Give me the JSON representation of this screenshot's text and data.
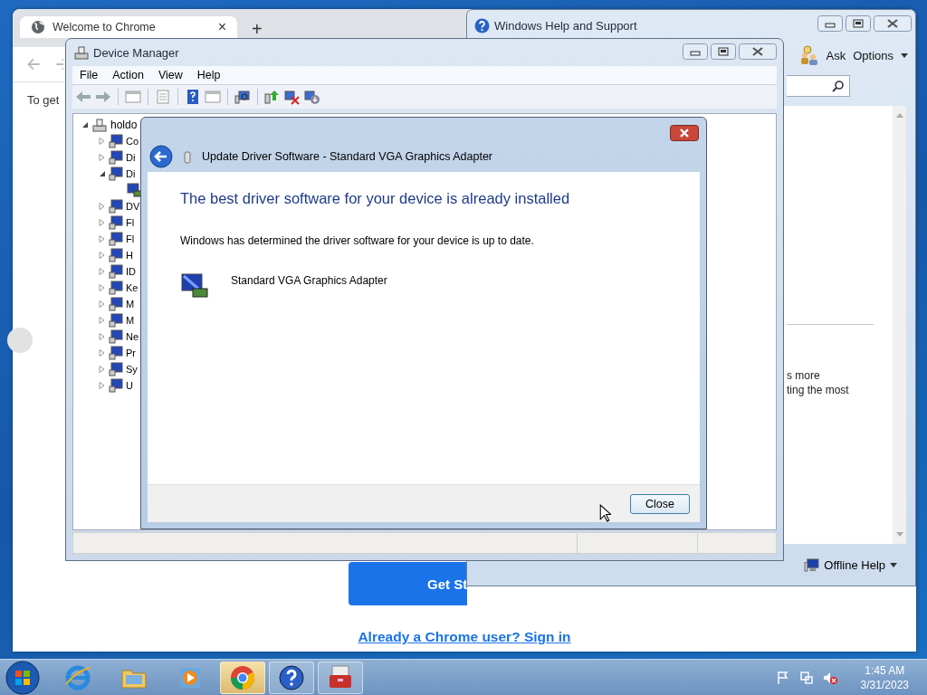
{
  "chrome_window": {
    "tab": {
      "title": "Welcome to Chrome",
      "close": "×"
    },
    "new_tab": "+",
    "page_text": "To get",
    "get_started_button": "Get St",
    "sign_in_link": "Already a Chrome user? Sign in"
  },
  "help_window": {
    "title": "Windows Help and Support",
    "ask": "Ask",
    "options": "Options",
    "content_lines": [
      "s more",
      "ting the most"
    ],
    "offline_help": "Offline Help"
  },
  "device_manager": {
    "title": "Device Manager",
    "menu": [
      "File",
      "Action",
      "View",
      "Help"
    ],
    "tree": {
      "label": "holdo",
      "expanded": true,
      "children": [
        {
          "label": "Co",
          "expanded": false
        },
        {
          "label": "Di",
          "expanded": false
        },
        {
          "label": "Di",
          "expanded": true,
          "children": [
            {
              "kind": "adapter"
            }
          ]
        },
        {
          "label": "DV",
          "expanded": false
        },
        {
          "label": "Fl",
          "expanded": false
        },
        {
          "label": "Fl",
          "expanded": false
        },
        {
          "label": "H",
          "expanded": false
        },
        {
          "label": "ID",
          "expanded": false
        },
        {
          "label": "Ke",
          "expanded": false
        },
        {
          "label": "M",
          "expanded": false
        },
        {
          "label": "M",
          "expanded": false
        },
        {
          "label": "Ne",
          "expanded": false
        },
        {
          "label": "Pr",
          "expanded": false
        },
        {
          "label": "Sy",
          "expanded": false
        },
        {
          "label": "U",
          "expanded": false
        }
      ]
    }
  },
  "dialog": {
    "title": "Update Driver Software - Standard VGA Graphics Adapter",
    "heading": "The best driver software for your device is already installed",
    "message": "Windows has determined the driver software for your device is up to date.",
    "device_name": "Standard VGA Graphics Adapter",
    "close_button": "Close"
  },
  "taskbar": {
    "apps": [
      {
        "kind": "ie",
        "open": false,
        "selected": false
      },
      {
        "kind": "folder",
        "open": false,
        "selected": false
      },
      {
        "kind": "media",
        "open": false,
        "selected": false
      },
      {
        "kind": "chrome",
        "open": true,
        "selected": true
      },
      {
        "kind": "help",
        "open": true,
        "selected": false
      },
      {
        "kind": "toolbox",
        "open": true,
        "selected": false
      }
    ],
    "volume_muted": true,
    "time": "1:45 AM",
    "date": "3/31/2023"
  }
}
